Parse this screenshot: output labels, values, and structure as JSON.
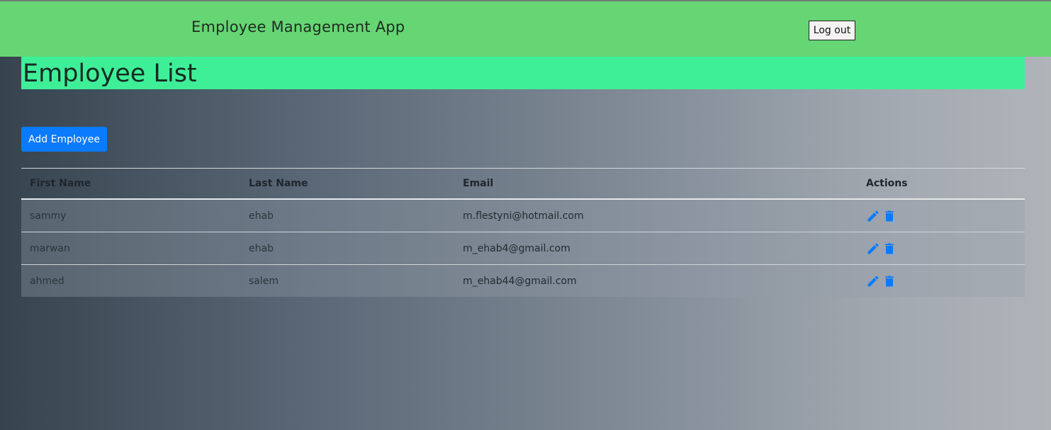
{
  "header": {
    "app_title": "Employee Management App",
    "logout_label": "Log out"
  },
  "page": {
    "title": "Employee List",
    "add_button_label": "Add Employee"
  },
  "table": {
    "columns": [
      "First Name",
      "Last Name",
      "Email",
      "Actions"
    ],
    "rows": [
      {
        "first_name": "sammy",
        "last_name": "ehab",
        "email": "m.flestyni@hotmail.com"
      },
      {
        "first_name": "marwan",
        "last_name": "ehab",
        "email": "m_ehab4@gmail.com"
      },
      {
        "first_name": "ahmed",
        "last_name": "salem",
        "email": "m_ehab44@gmail.com"
      }
    ],
    "row_actions": [
      "edit-icon",
      "delete-icon"
    ]
  },
  "colors": {
    "header_bg": "#66d573",
    "title_bar_bg": "#3fef98",
    "accent_blue": "#0a7bff"
  }
}
